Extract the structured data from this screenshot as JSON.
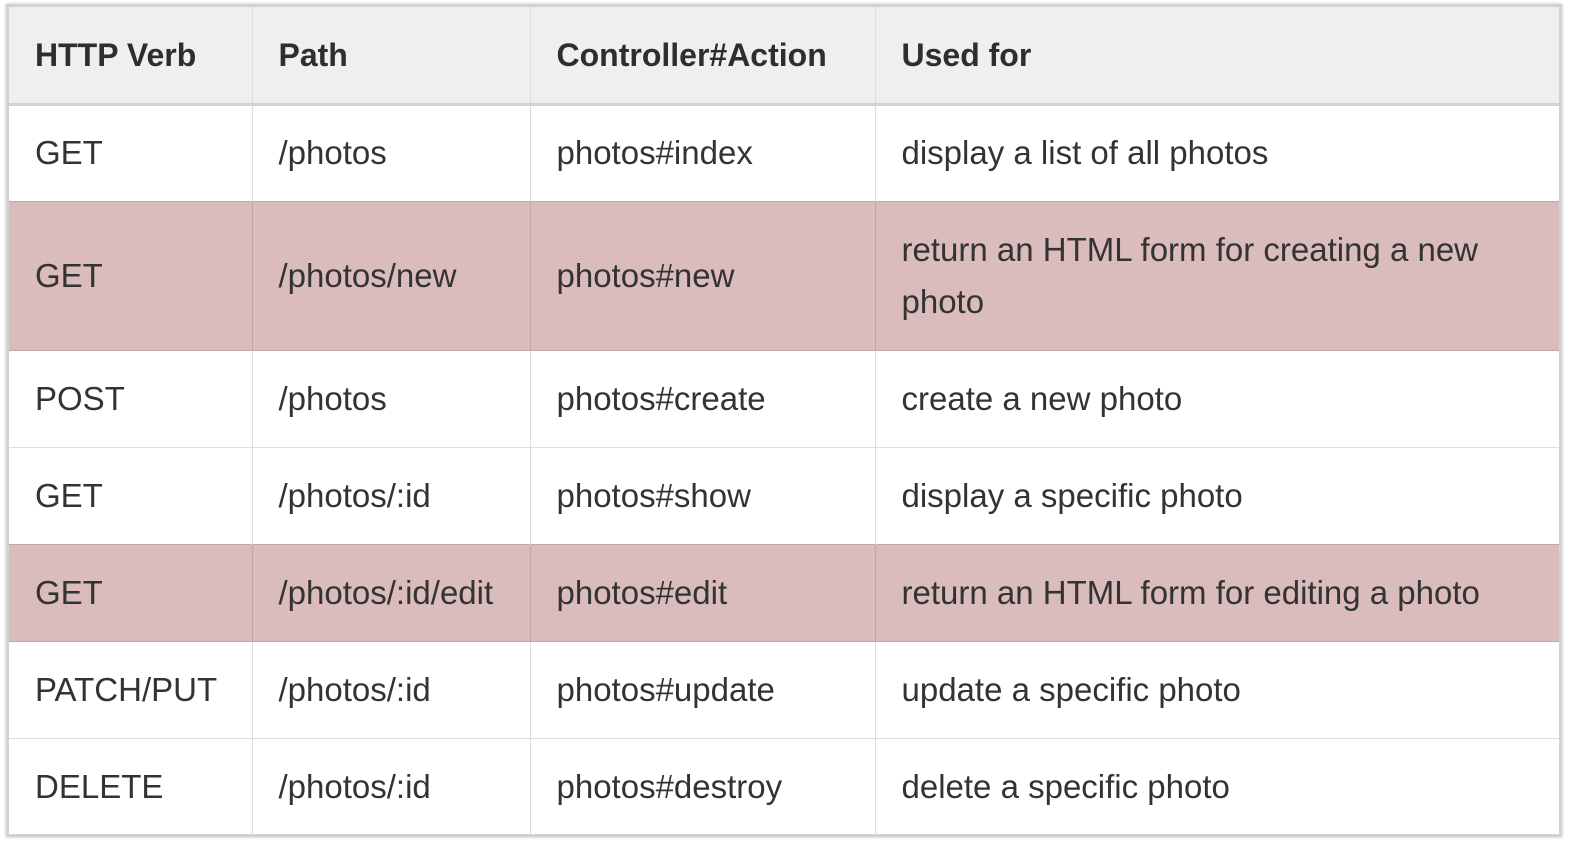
{
  "table": {
    "headers": [
      "HTTP Verb",
      "Path",
      "Controller#Action",
      "Used for"
    ],
    "highlight_color": "#dbbcbc",
    "header_bg": "#efefef",
    "rows": [
      {
        "verb": "GET",
        "path": "/photos",
        "action": "photos#index",
        "used_for": "display a list of all photos",
        "highlighted": false
      },
      {
        "verb": "GET",
        "path": "/photos/new",
        "action": "photos#new",
        "used_for": "return an HTML form for creating a new photo",
        "highlighted": true
      },
      {
        "verb": "POST",
        "path": "/photos",
        "action": "photos#create",
        "used_for": "create a new photo",
        "highlighted": false
      },
      {
        "verb": "GET",
        "path": "/photos/:id",
        "action": "photos#show",
        "used_for": "display a specific photo",
        "highlighted": false
      },
      {
        "verb": "GET",
        "path": "/photos/:id/edit",
        "action": "photos#edit",
        "used_for": "return an HTML form for editing a photo",
        "highlighted": true
      },
      {
        "verb": "PATCH/PUT",
        "path": "/photos/:id",
        "action": "photos#update",
        "used_for": "update a specific photo",
        "highlighted": false
      },
      {
        "verb": "DELETE",
        "path": "/photos/:id",
        "action": "photos#destroy",
        "used_for": "delete a specific photo",
        "highlighted": false
      }
    ]
  }
}
